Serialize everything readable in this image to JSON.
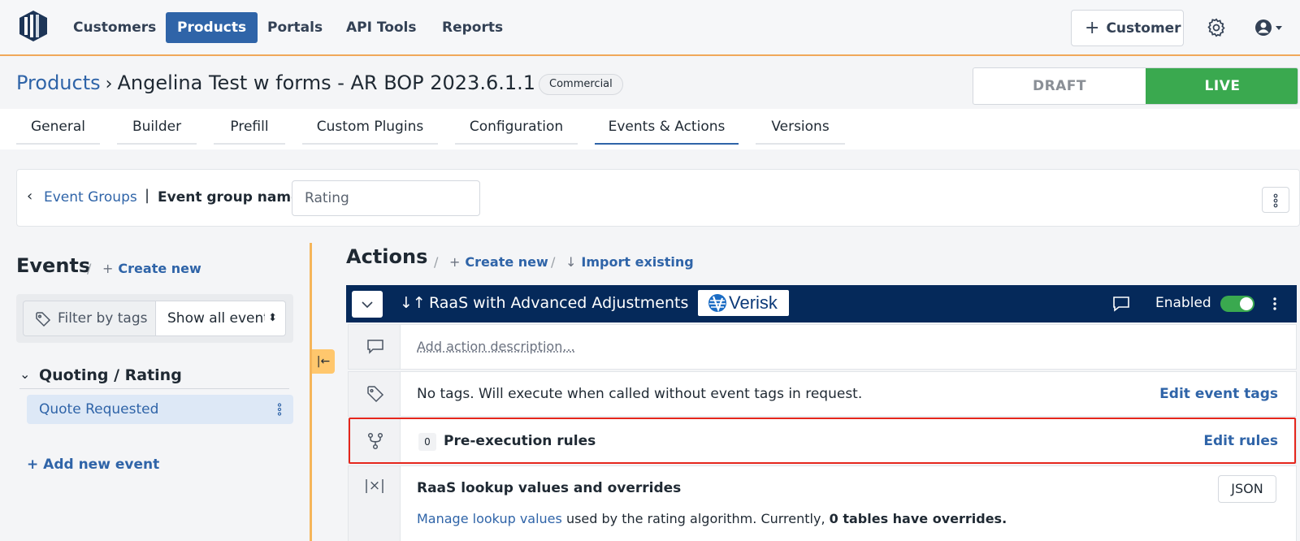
{
  "nav": {
    "items": [
      "Customers",
      "Products",
      "Portals",
      "API Tools",
      "Reports"
    ],
    "active": "Products",
    "customer_button": "Customer"
  },
  "header": {
    "breadcrumb_root": "Products",
    "title": "Angelina Test w forms - AR BOP 2023.6.1.1",
    "type_badge": "Commercial",
    "status": {
      "draft": "DRAFT",
      "live": "LIVE",
      "selected": "LIVE"
    }
  },
  "tabs": [
    "General",
    "Builder",
    "Prefill",
    "Custom Plugins",
    "Configuration",
    "Events & Actions",
    "Versions"
  ],
  "active_tab": "Events & Actions",
  "event_group": {
    "back_link": "Event Groups",
    "name_label": "Event group name:",
    "name_value": "Rating"
  },
  "events": {
    "title": "Events",
    "create_new": "Create new",
    "filter_label": "Filter by tags",
    "filter_select": "Show all events",
    "groups": [
      {
        "name": "Quoting / Rating",
        "items": [
          "Quote Requested"
        ]
      }
    ],
    "add_event": "+ Add new event"
  },
  "actions": {
    "title": "Actions",
    "create_new": "Create new",
    "import_existing": "Import existing",
    "action": {
      "name": "RaaS with Advanced Adjustments",
      "vendor_logo": "Verisk",
      "enabled_label": "Enabled",
      "enabled": true,
      "description_placeholder": "Add action description...",
      "tags_text": "No tags. Will execute when called without event tags in request.",
      "edit_tags": "Edit event tags",
      "rules_count": "0",
      "rules_label": "Pre-execution rules",
      "edit_rules": "Edit rules",
      "lookup_title": "RaaS lookup values and overrides",
      "lookup_symbol": "|×|",
      "json_button": "JSON",
      "manage_link": "Manage lookup values",
      "manage_text": " used by the rating algorithm. Currently, ",
      "overrides_text": "0 tables have overrides."
    }
  },
  "colors": {
    "brand_blue": "#2f64a8",
    "navy": "#05295a",
    "live_green": "#3aa94f",
    "highlight_red": "#e5261c",
    "accent_orange": "#f5b55a"
  }
}
